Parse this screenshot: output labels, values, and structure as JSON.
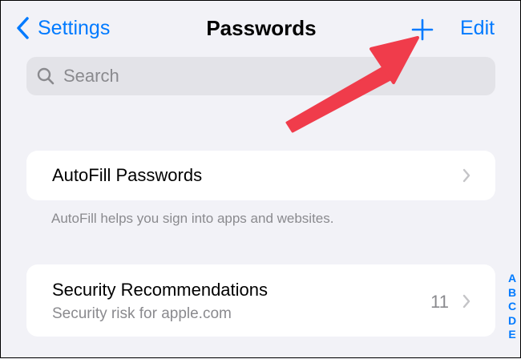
{
  "nav": {
    "back_label": "Settings",
    "title": "Passwords",
    "edit_label": "Edit"
  },
  "search": {
    "placeholder": "Search"
  },
  "autofill": {
    "label": "AutoFill Passwords",
    "footnote": "AutoFill helps you sign into apps and websites."
  },
  "security": {
    "title": "Security Recommendations",
    "subtitle": "Security risk for apple.com",
    "count": "11"
  },
  "index_letters": [
    "A",
    "B",
    "C",
    "D",
    "E"
  ],
  "colors": {
    "accent": "#007aff",
    "background": "#f2f2f7",
    "annotation_arrow": "#f03c4b"
  },
  "icons": {
    "back": "chevron-left-icon",
    "add": "plus-icon",
    "search": "magnifier-icon",
    "row_disclosure": "chevron-right-icon"
  }
}
